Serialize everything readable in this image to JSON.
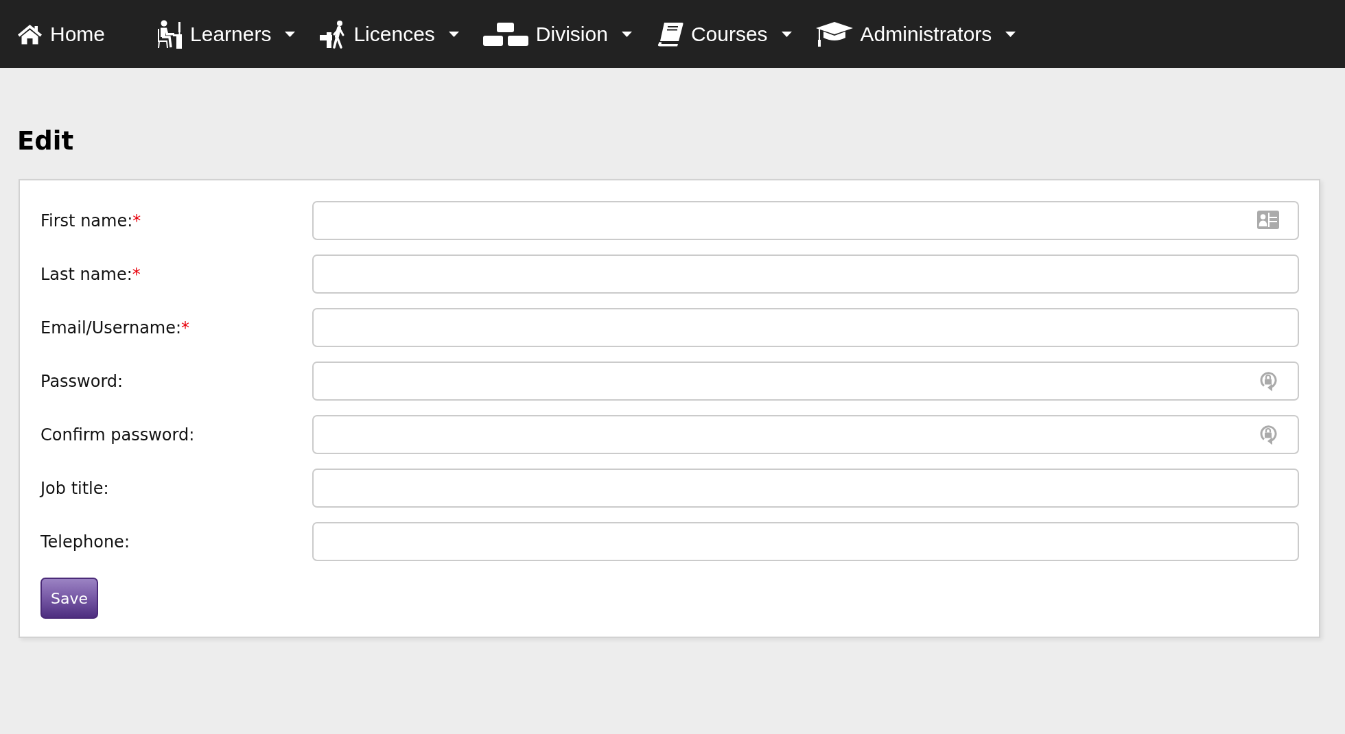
{
  "nav": {
    "items": [
      {
        "label": "Home",
        "dropdown": false
      },
      {
        "label": "Learners",
        "dropdown": true
      },
      {
        "label": "Licences",
        "dropdown": true
      },
      {
        "label": "Division",
        "dropdown": true
      },
      {
        "label": "Courses",
        "dropdown": true
      },
      {
        "label": "Administrators",
        "dropdown": true
      }
    ]
  },
  "page": {
    "title": "Edit"
  },
  "form": {
    "fields": [
      {
        "label": "First name:",
        "required_mark": "*",
        "kind": "contact"
      },
      {
        "label": "Last name:",
        "required_mark": "*",
        "kind": "text"
      },
      {
        "label": "Email/Username:",
        "required_mark": "*",
        "kind": "text"
      },
      {
        "label": "Password:",
        "kind": "password"
      },
      {
        "label": "Confirm password:",
        "kind": "password"
      },
      {
        "label": "Job title:",
        "kind": "text"
      },
      {
        "label": "Telephone:",
        "kind": "text"
      }
    ],
    "submit_button": {
      "label": "Save"
    }
  }
}
